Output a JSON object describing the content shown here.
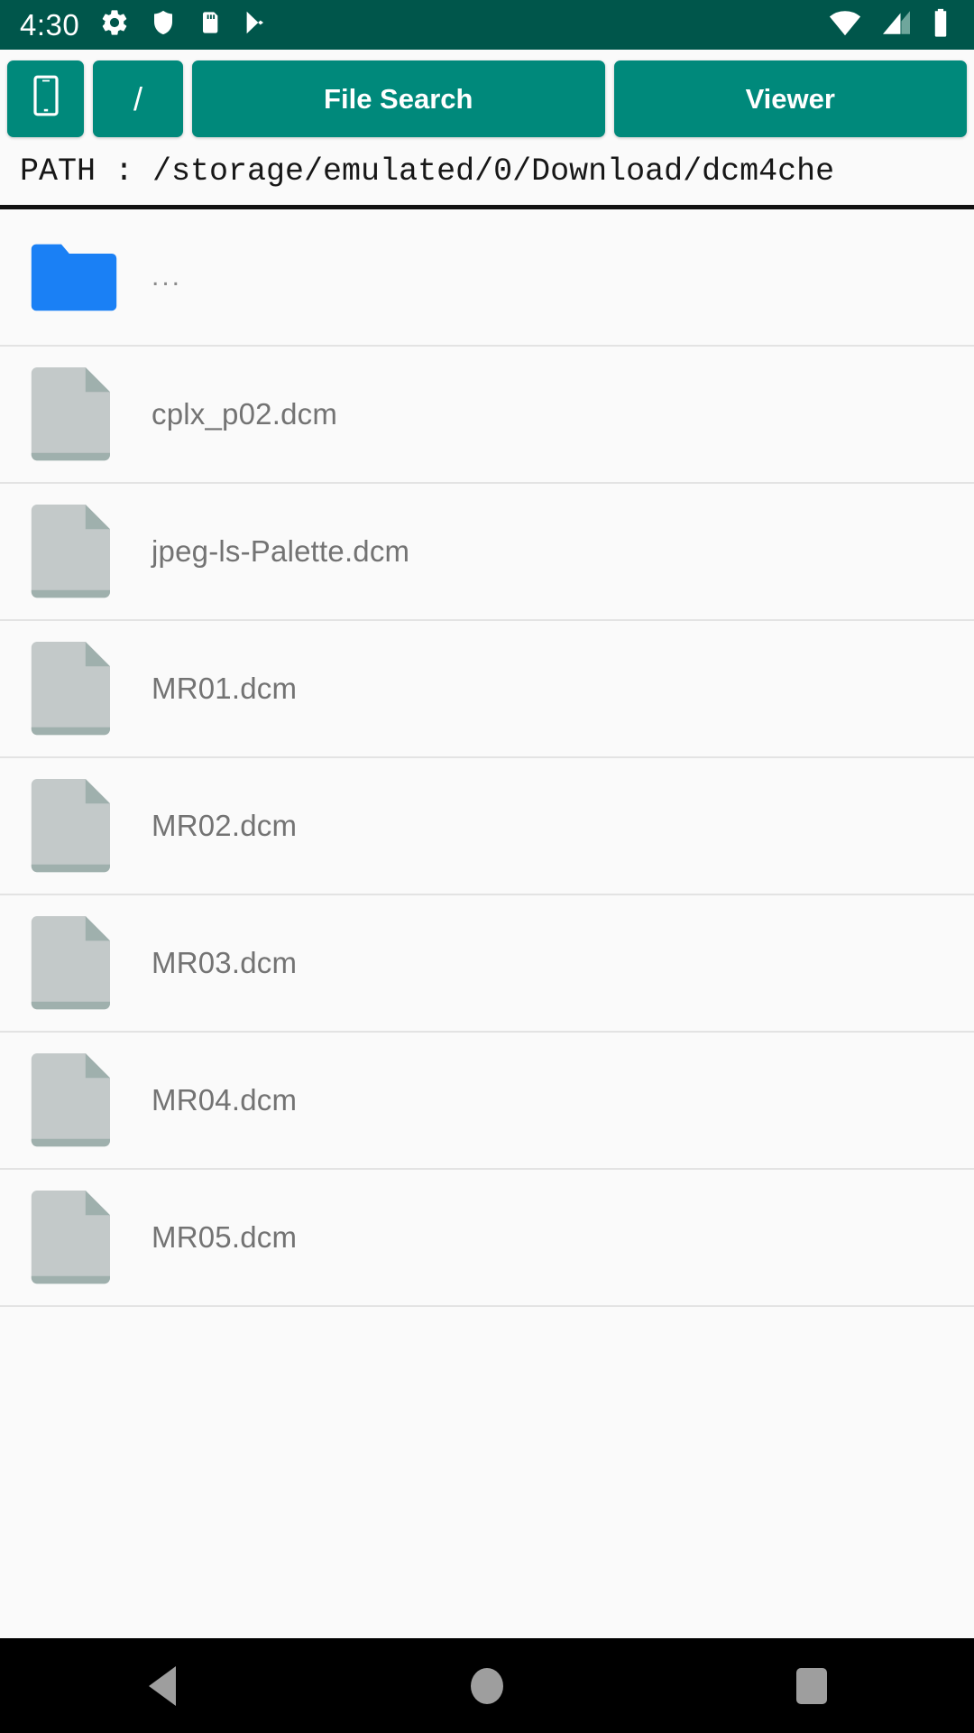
{
  "statusbar": {
    "time": "4:30",
    "left_icons": [
      "gear-icon",
      "shield-icon",
      "sd-card-icon",
      "play-store-icon"
    ],
    "right_icons": [
      "wifi-icon",
      "cellular-signal-icon",
      "battery-icon"
    ],
    "background_color": "#00564b"
  },
  "toolbar": {
    "accent_color": "#00897b",
    "phone_button_label": "",
    "root_button_label": "/",
    "file_search_label": "File Search",
    "viewer_label": "Viewer"
  },
  "path": {
    "text": "PATH :  /storage/emulated/0/Download/dcm4che"
  },
  "files": [
    {
      "name": "...",
      "type": "folder",
      "icon": "folder-icon"
    },
    {
      "name": "cplx_p02.dcm",
      "type": "file",
      "icon": "file-icon"
    },
    {
      "name": "jpeg-ls-Palette.dcm",
      "type": "file",
      "icon": "file-icon"
    },
    {
      "name": "MR01.dcm",
      "type": "file",
      "icon": "file-icon"
    },
    {
      "name": "MR02.dcm",
      "type": "file",
      "icon": "file-icon"
    },
    {
      "name": "MR03.dcm",
      "type": "file",
      "icon": "file-icon"
    },
    {
      "name": "MR04.dcm",
      "type": "file",
      "icon": "file-icon"
    },
    {
      "name": "MR05.dcm",
      "type": "file",
      "icon": "file-icon"
    }
  ],
  "navbar": {
    "back_label": "Back",
    "home_label": "Home",
    "recents_label": "Recents"
  },
  "colors": {
    "folder_blue": "#1a80f5",
    "file_gray": "#c3c9c9",
    "background": "#fafafa",
    "divider": "#e3e3e3"
  }
}
